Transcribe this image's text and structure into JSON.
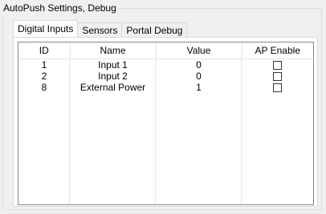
{
  "group": {
    "title": "AutoPush Settings, Debug"
  },
  "tabs": [
    {
      "label": "Digital Inputs",
      "active": true
    },
    {
      "label": "Sensors",
      "active": false
    },
    {
      "label": "Portal Debug",
      "active": false
    }
  ],
  "table": {
    "columns": [
      "ID",
      "Name",
      "Value",
      "AP Enable"
    ],
    "rows": [
      {
        "id": "1",
        "name": "Input 1",
        "value": "0",
        "ap_enable": false
      },
      {
        "id": "2",
        "name": "Input 2",
        "value": "0",
        "ap_enable": false
      },
      {
        "id": "8",
        "name": "External Power",
        "value": "1",
        "ap_enable": false
      }
    ]
  }
}
